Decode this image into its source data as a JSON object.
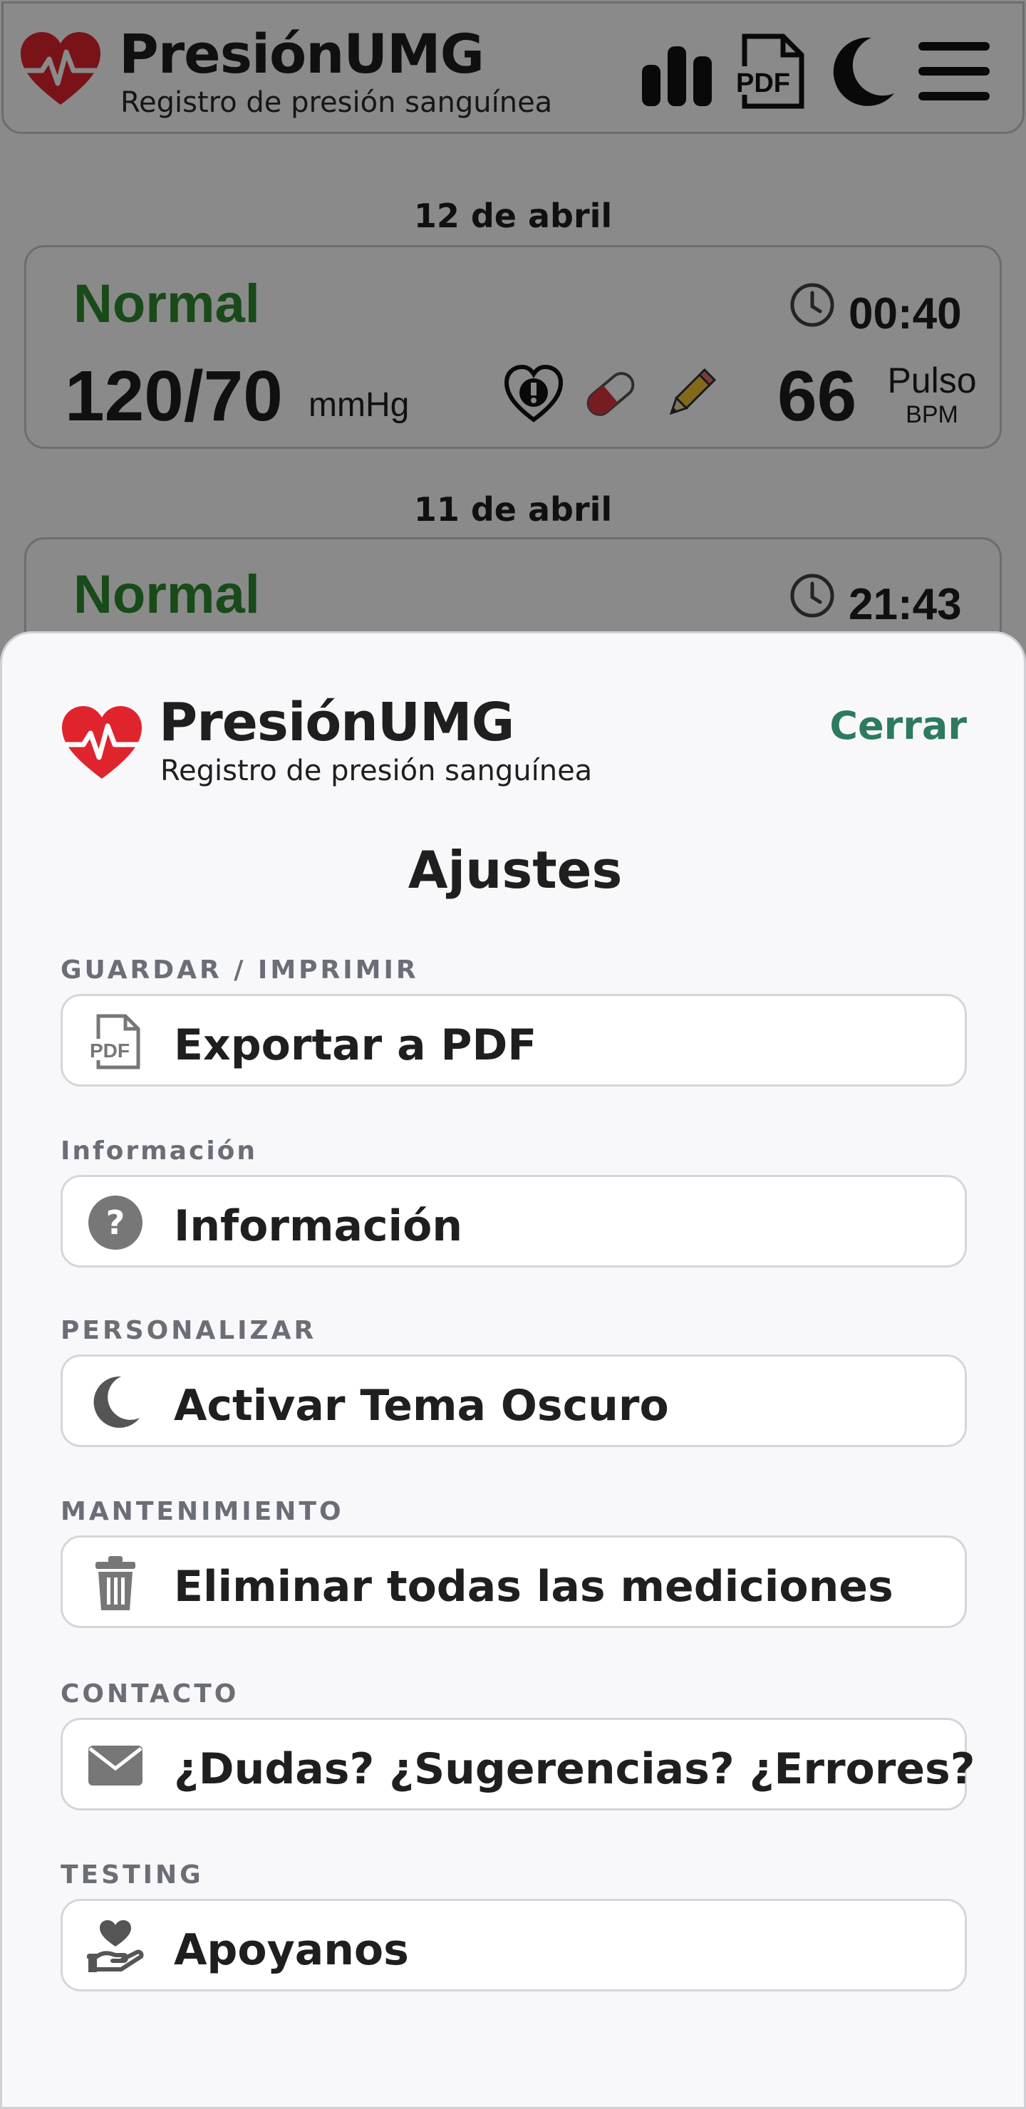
{
  "app": {
    "title": "PresiónUMG",
    "subtitle": "Registro de presión sanguínea"
  },
  "header_icons": [
    "chart-icon",
    "pdf-icon",
    "moon-icon",
    "menu-icon"
  ],
  "readings": [
    {
      "date": "12 de abril",
      "status": "Normal",
      "time": "00:40",
      "bp": "120/70",
      "bp_unit": "mmHg",
      "pulse": "66",
      "pulse_label": "Pulso",
      "pulse_unit": "BPM",
      "icons": [
        "heart-alert-icon",
        "pill-icon",
        "pencil-icon"
      ]
    },
    {
      "date": "11 de abril",
      "status": "Normal",
      "time": "21:43"
    }
  ],
  "settings": {
    "close_label": "Cerrar",
    "title": "Ajustes",
    "sections": [
      {
        "label": "GUARDAR / IMPRIMIR",
        "button": "Exportar a PDF",
        "icon": "pdf-icon"
      },
      {
        "label": "Información",
        "button": "Información",
        "icon": "question-icon"
      },
      {
        "label": "PERSONALIZAR",
        "button": "Activar Tema Oscuro",
        "icon": "moon-icon"
      },
      {
        "label": "MANTENIMIENTO",
        "button": "Eliminar todas las mediciones",
        "icon": "trash-icon"
      },
      {
        "label": "CONTACTO",
        "button": "¿Dudas? ¿Sugerencias? ¿Errores?",
        "icon": "envelope-icon"
      },
      {
        "label": "TESTING",
        "button": "Apoyanos",
        "icon": "hand-heart-icon"
      }
    ]
  },
  "colors": {
    "status_normal": "#2f8a2f",
    "close_link": "#2d7a5f",
    "logo_red": "#e0242e"
  }
}
